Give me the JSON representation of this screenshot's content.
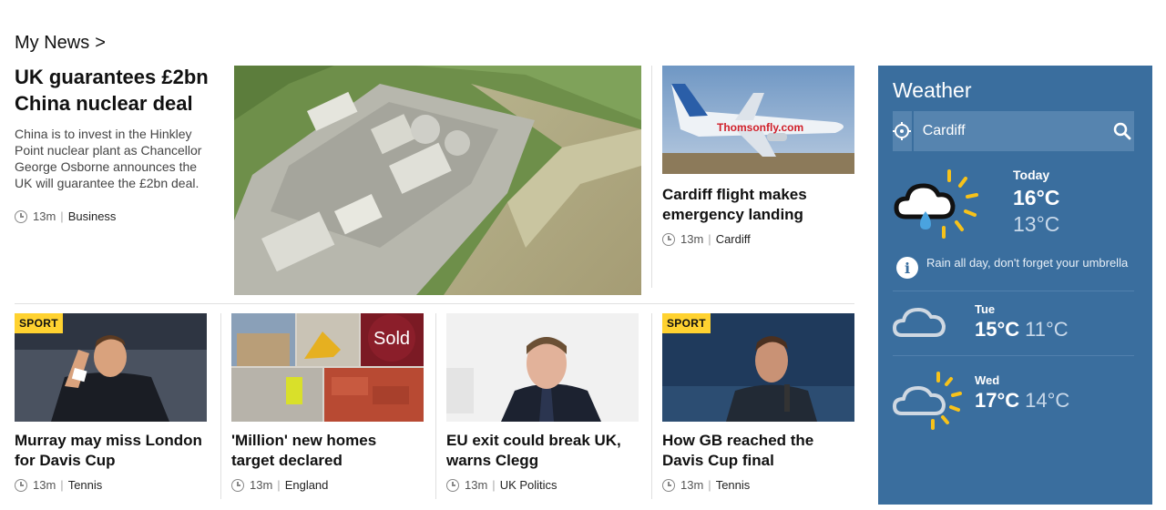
{
  "section": {
    "title": "My News",
    "chevron": ">"
  },
  "lead": {
    "title": "UK guarantees £2bn China nuclear deal",
    "summary": "China is to invest in the Hinkley Point nuclear plant as Chancellor George Osborne announces the UK will guarantee the £2bn deal.",
    "time": "13m",
    "category": "Business"
  },
  "side_story": {
    "title": "Cardiff flight makes emergency landing",
    "time": "13m",
    "category": "Cardiff",
    "plane_text": "Thomsonfly.com"
  },
  "cards": [
    {
      "badge": "SPORT",
      "title": "Murray may miss London for Davis Cup",
      "time": "13m",
      "category": "Tennis"
    },
    {
      "badge": "",
      "title": "'Million' new homes target declared",
      "time": "13m",
      "category": "England",
      "sign_text": "Sold"
    },
    {
      "badge": "",
      "title": "EU exit could break UK, warns Clegg",
      "time": "13m",
      "category": "UK Politics"
    },
    {
      "badge": "SPORT",
      "title": "How GB reached the Davis Cup final",
      "time": "13m",
      "category": "Tennis"
    }
  ],
  "weather": {
    "title": "Weather",
    "location": "Cardiff",
    "today": {
      "day": "Today",
      "max": "16°C",
      "min": "13°C",
      "icon": "cloud-sun-rain-icon"
    },
    "info": "Rain all day, don't forget your umbrella",
    "forecast": [
      {
        "day": "Tue",
        "max": "15°C",
        "min": "11°C",
        "icon": "cloud-icon"
      },
      {
        "day": "Wed",
        "max": "17°C",
        "min": "14°C",
        "icon": "sun-cloud-icon"
      }
    ],
    "colors": {
      "panel": "#3a6e9e",
      "search": "#5684af",
      "sun": "#f7c21a",
      "rain": "#4aa3df"
    }
  },
  "colors": {
    "badge": "#ffd230"
  }
}
